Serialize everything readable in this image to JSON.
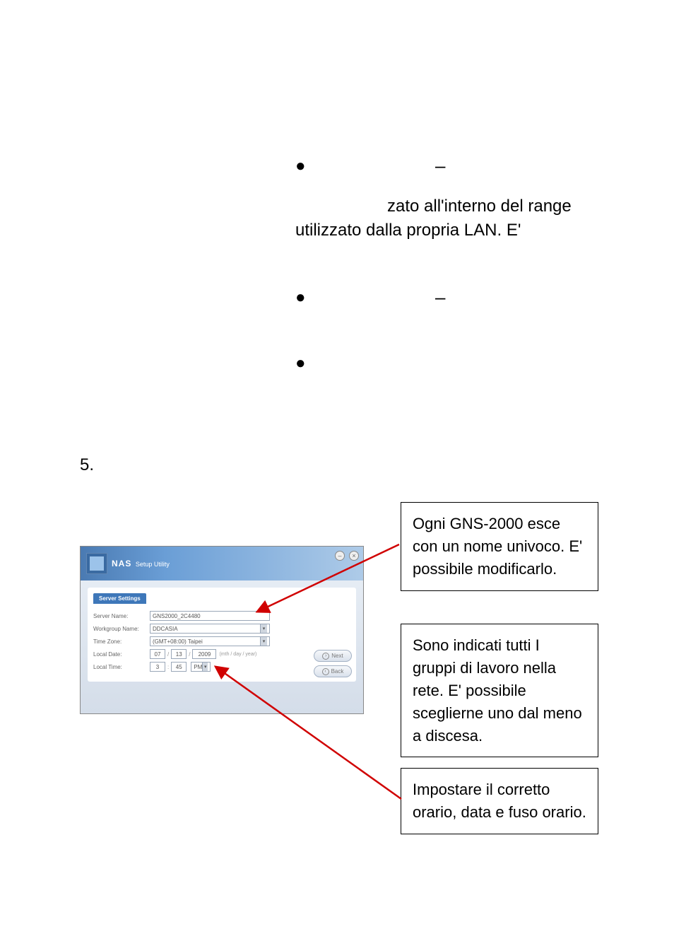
{
  "bullets": {
    "b1_text": "zato all'interno del range utilizzato dalla propria LAN. E'"
  },
  "step": {
    "number": "5."
  },
  "callouts": {
    "c1": "Ogni GNS-2000 esce con un nome univoco. E' possibile modificarlo.",
    "c2": "Sono indicati tutti I gruppi di lavoro nella rete. E' possibile sceglierne uno dal meno a discesa.",
    "c3": "Impostare il corretto orario, data e fuso orario."
  },
  "utility": {
    "title": "NAS",
    "subtitle": "Setup Utility",
    "tab": "Server Settings",
    "labels": {
      "server_name": "Server Name:",
      "workgroup": "Workgroup Name:",
      "timezone": "Time Zone:",
      "local_date": "Local Date:",
      "local_time": "Local Time:"
    },
    "values": {
      "server_name": "GNS2000_2C4480",
      "workgroup": "DDCASIA",
      "timezone": "(GMT+08:00) Taipei",
      "date_m": "07",
      "date_d": "13",
      "date_y": "2009",
      "date_hint": "(mth / day / year)",
      "time_h": "3",
      "time_m": "45",
      "ampm": "PM"
    },
    "buttons": {
      "next": "Next",
      "back": "Back"
    },
    "winbtn_min": "–",
    "winbtn_close": "×"
  }
}
